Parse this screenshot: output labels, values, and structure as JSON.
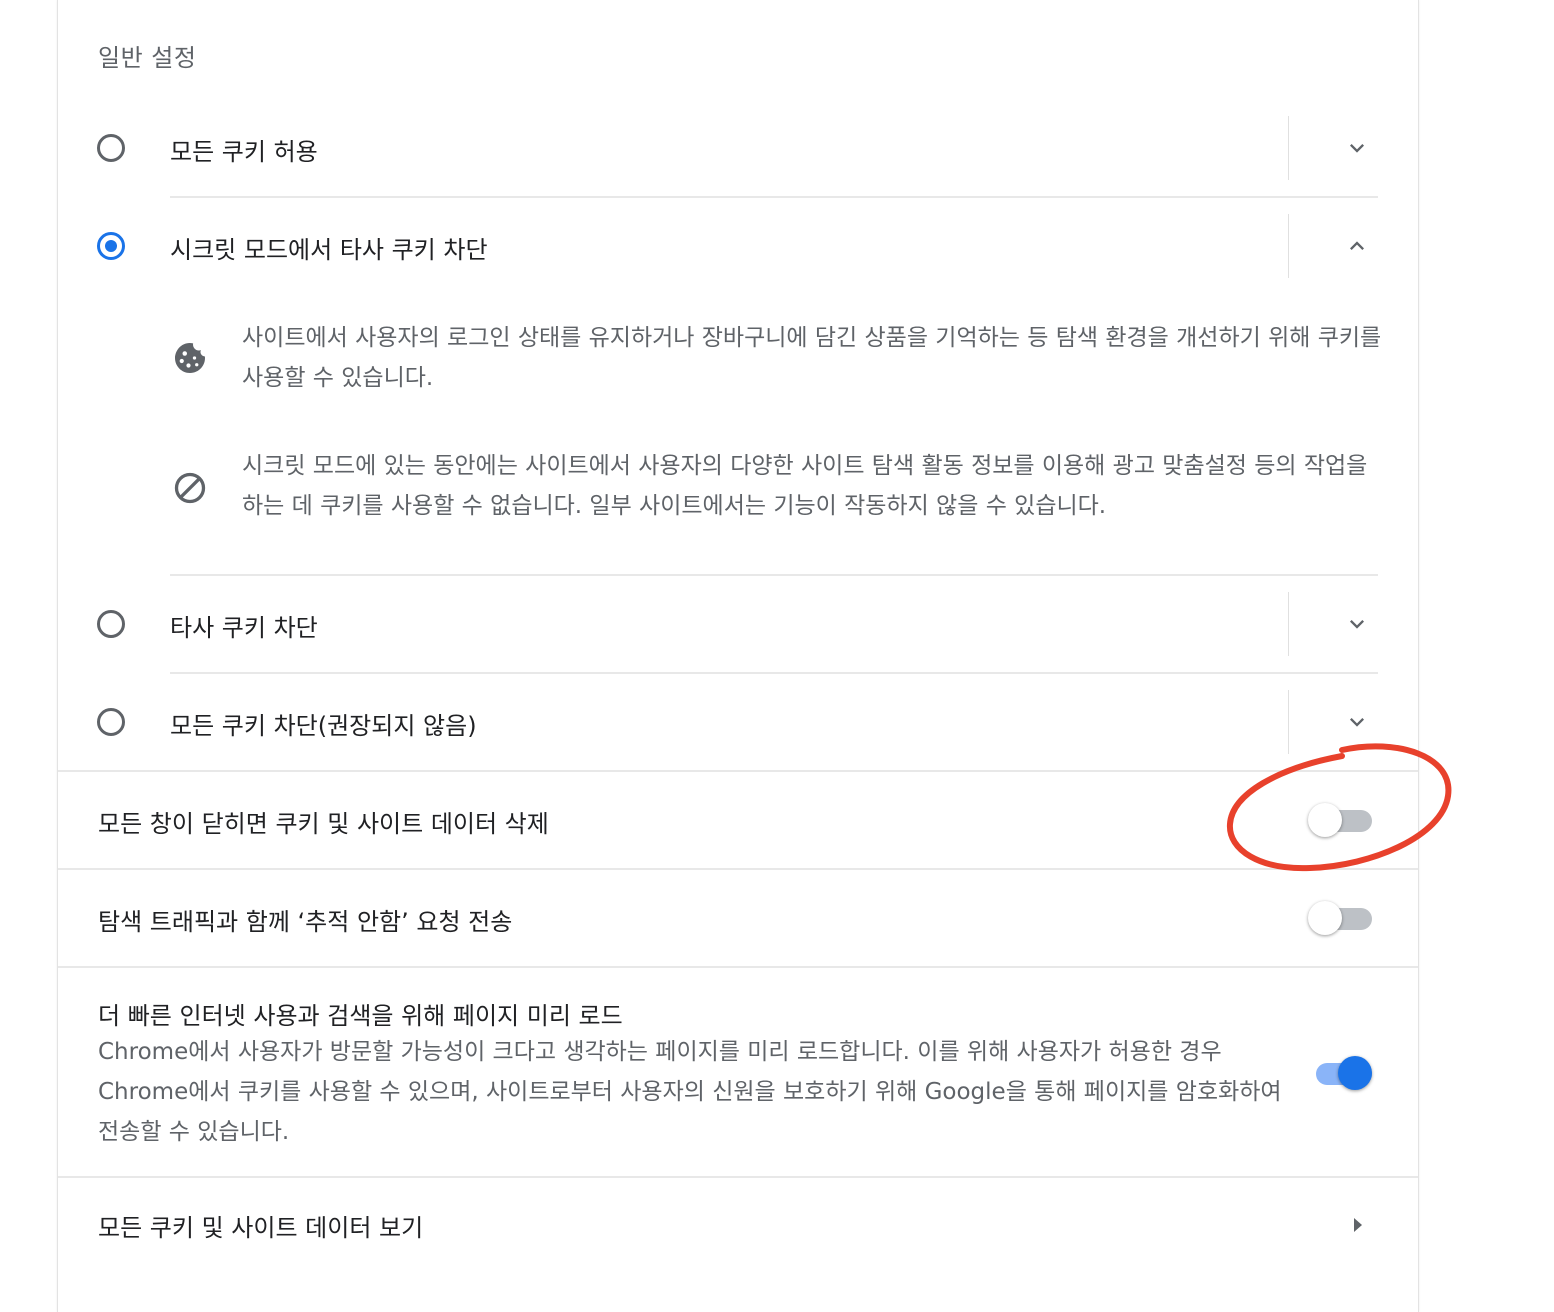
{
  "section": {
    "title": "일반 설정"
  },
  "radios": [
    {
      "label": "모든 쿠키 허용",
      "checked": false,
      "expanded": false
    },
    {
      "label": "시크릿 모드에서 타사 쿠키 차단",
      "checked": true,
      "expanded": true
    },
    {
      "label": "타사 쿠키 차단",
      "checked": false,
      "expanded": false
    },
    {
      "label": "모든 쿠키 차단(권장되지 않음)",
      "checked": false,
      "expanded": false
    }
  ],
  "expanded_details": [
    {
      "icon": "cookie-icon",
      "text": "사이트에서 사용자의 로그인 상태를 유지하거나 장바구니에 담긴 상품을 기억하는 등 탐색 환경을 개선하기 위해 쿠키를 사용할 수 있습니다."
    },
    {
      "icon": "block-icon",
      "text": "시크릿 모드에 있는 동안에는 사이트에서 사용자의 다양한 사이트 탐색 활동 정보를 이용해 광고 맞춤설정 등의 작업을 하는 데 쿠키를 사용할 수 없습니다. 일부 사이트에서는 기능이 작동하지 않을 수 있습니다."
    }
  ],
  "toggles": {
    "clear_on_exit": {
      "label": "모든 창이 닫히면 쿠키 및 사이트 데이터 삭제",
      "on": false
    },
    "do_not_track": {
      "label": "탐색 트래픽과 함께 ‘추적 안함’ 요청 전송",
      "on": false
    },
    "preload": {
      "label": "더 빠른 인터넷 사용과 검색을 위해 페이지 미리 로드",
      "sublabel": "Chrome에서 사용자가 방문할 가능성이 크다고 생각하는 페이지를 미리 로드합니다. 이를 위해 사용자가 허용한 경우 Chrome에서 쿠키를 사용할 수 있으며, 사이트로부터 사용자의 신원을 보호하기 위해 Google을 통해 페이지를 암호화하여 전송할 수 있습니다.",
      "on": true
    }
  },
  "link_row": {
    "label": "모든 쿠키 및 사이트 데이터 보기"
  },
  "colors": {
    "accent": "#1a73e8",
    "annotation": "#e8412c"
  }
}
